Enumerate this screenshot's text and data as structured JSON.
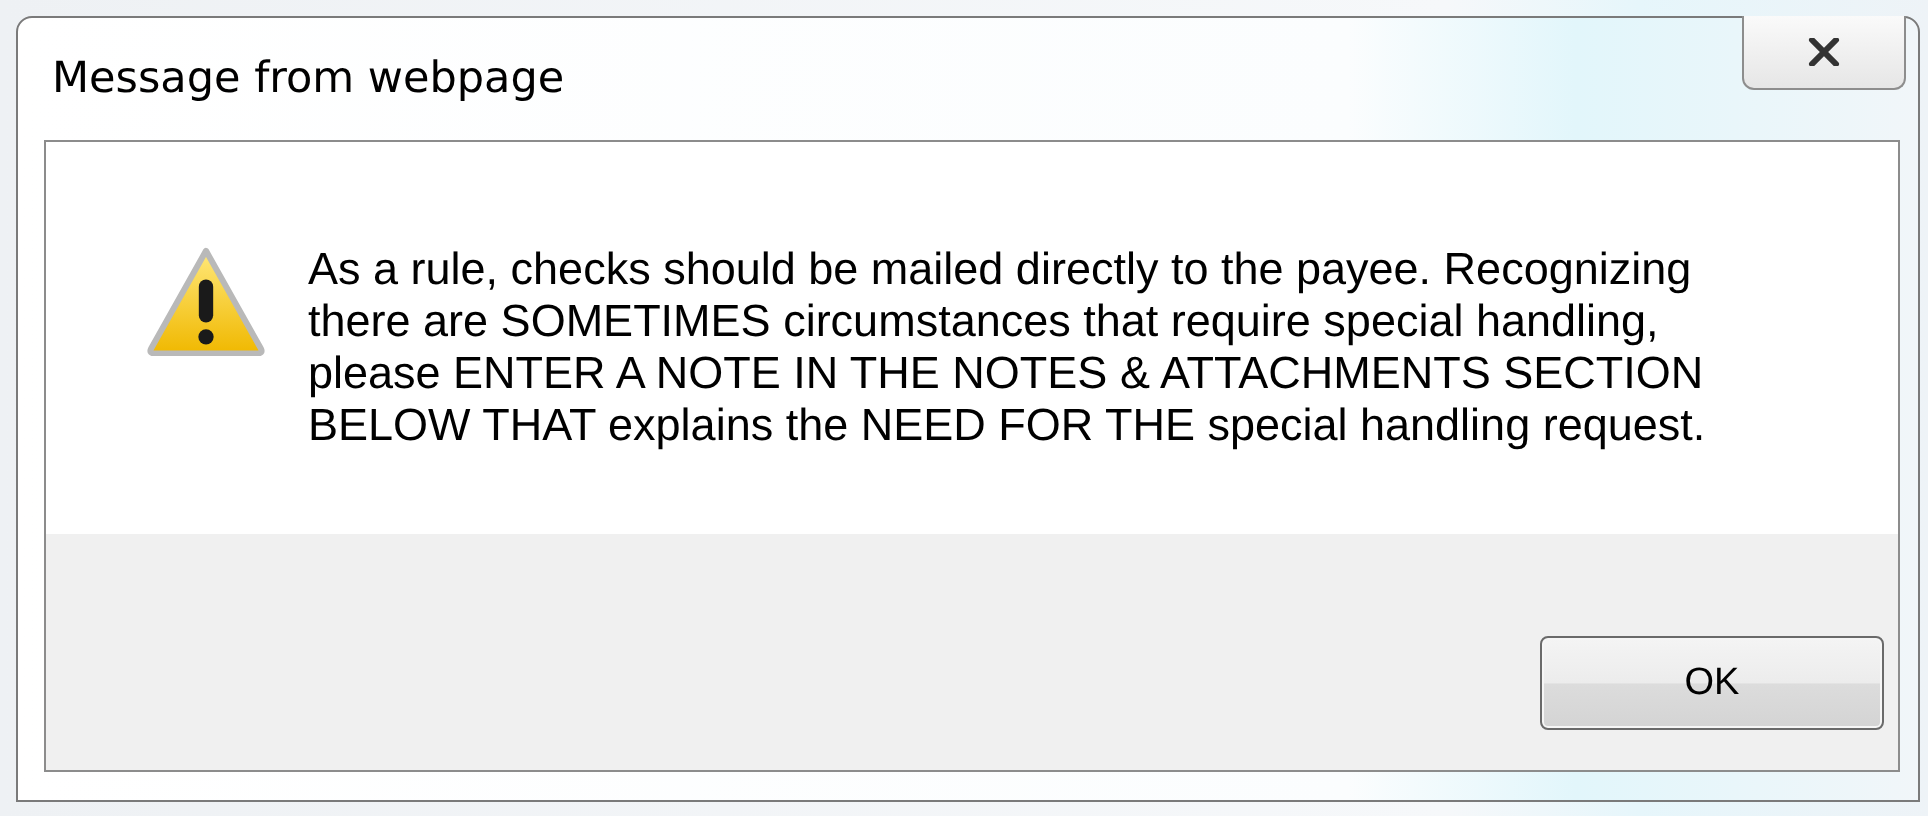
{
  "window": {
    "title": "Message from webpage"
  },
  "message": "As a rule, checks should be mailed directly to the payee. Recognizing\nthere are SOMETIMES circumstances that require special handling,\nplease ENTER A NOTE IN THE NOTES & ATTACHMENTS SECTION\nBELOW THAT explains the NEED FOR THE special handling request.",
  "buttons": [
    {
      "label": "OK",
      "kind": "default"
    }
  ]
}
